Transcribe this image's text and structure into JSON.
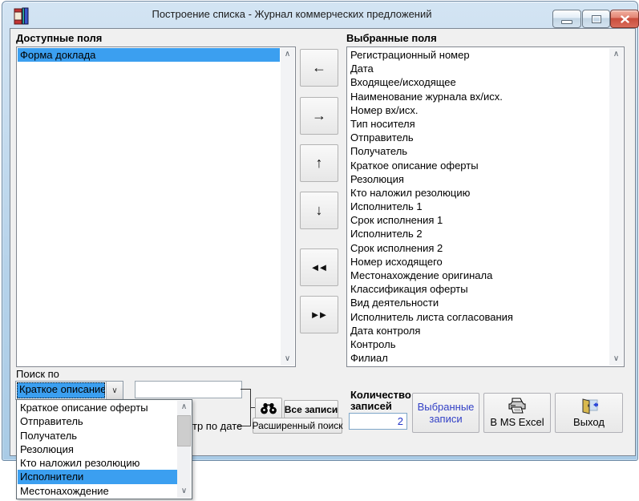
{
  "window": {
    "title": "Построение списка - Журнал коммерческих предложений"
  },
  "available_panel": {
    "label": "Доступные поля",
    "items": [
      "Форма доклада"
    ],
    "selected_index": 0
  },
  "selected_panel": {
    "label": "Выбранные поля",
    "items": [
      "Регистрационный номер",
      "Дата",
      "Входящее/исходящее",
      "Наименование журнала вх/исх.",
      "Номер вх/исх.",
      "Тип носителя",
      "Отправитель",
      "Получатель",
      "Краткое описание оферты",
      "Резолюция",
      "Кто наложил резолюцию",
      "Исполнитель 1",
      "Срок исполнения 1",
      "Исполнитель 2",
      "Срок исполнения 2",
      "Номер исходящего",
      "Местонахождение оригинала",
      "Классификация оферты",
      "Вид деятельности",
      "Исполнитель листа согласования",
      "Дата контроля",
      "Контроль",
      "Филиал"
    ]
  },
  "transfer": {
    "left": "←",
    "right": "→",
    "up": "↑",
    "down": "↓",
    "double_left": "◄◄",
    "double_right": "►►"
  },
  "search": {
    "label": "Поиск по",
    "combo_value": "Краткое описание оф",
    "input_value": "",
    "all_records": "Все записи",
    "advanced_search": "Расширенный поиск",
    "date_filter_visible_text": "тр по дате",
    "dropdown": {
      "items": [
        "Краткое описание оферты",
        "Отправитель",
        "Получатель",
        "Резолюция",
        "Кто наложил резолюцию",
        "Исполнители",
        "Местонахождение"
      ],
      "selected_index": 5
    }
  },
  "records": {
    "label_line1": "Количество",
    "label_line2": "записей",
    "count": "2"
  },
  "actions": {
    "selected_records_line1": "Выбранные",
    "selected_records_line2": "записи",
    "excel": "В MS Excel",
    "exit": "Выход"
  },
  "icons": {
    "scroll_up": "∧",
    "scroll_down": "∨",
    "combo_chevron": "∨"
  },
  "colors": {
    "selection_blue": "#3b9ff0",
    "accent_blue_text": "#3341c6",
    "close_button_red": "#c94c3a",
    "frame_blue": "#b5d2ea",
    "client_gray": "#f0f0f0"
  }
}
